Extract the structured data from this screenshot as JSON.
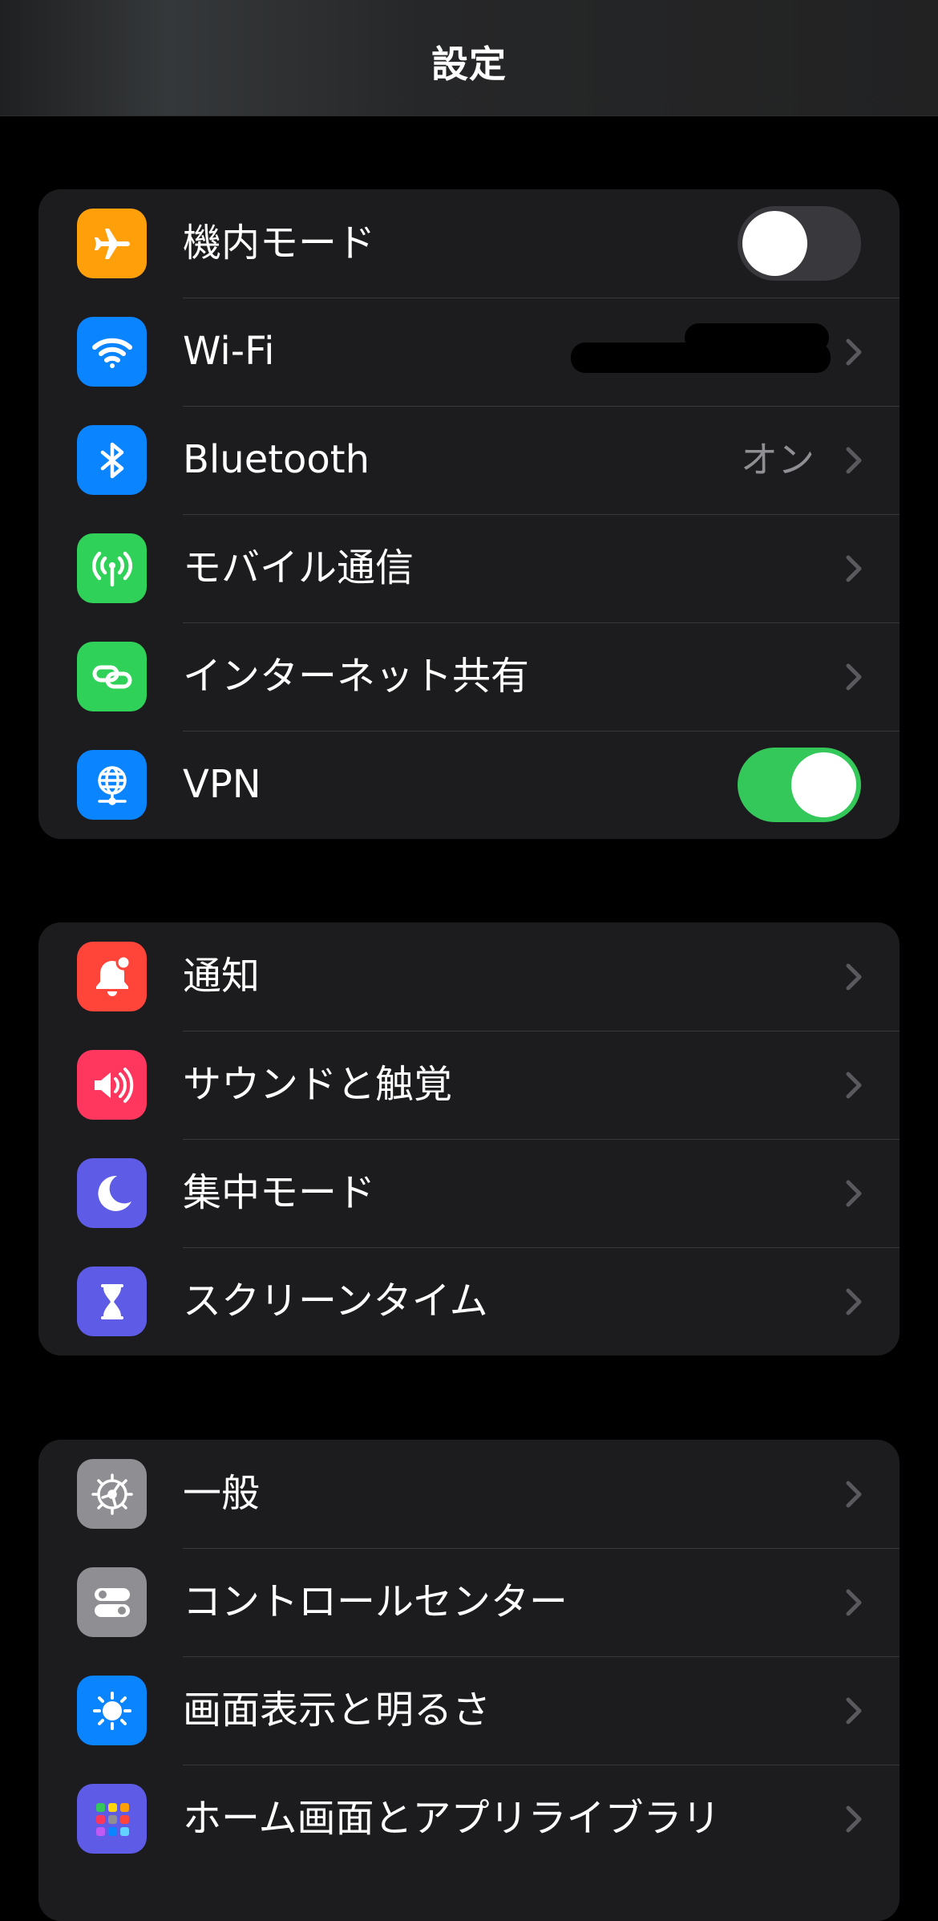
{
  "nav": {
    "title": "設定"
  },
  "groups": [
    {
      "rows": [
        {
          "label": "機内モード",
          "icon": "airplane-icon",
          "color": "#ff9f0a",
          "control": "toggle-off"
        },
        {
          "label": "Wi-Fi",
          "icon": "wifi-icon",
          "color": "#0a84ff",
          "control": "chevron",
          "value": ""
        },
        {
          "label": "Bluetooth",
          "icon": "bluetooth-icon",
          "color": "#0a84ff",
          "control": "chevron",
          "value": "オン"
        },
        {
          "label": "モバイル通信",
          "icon": "cellular-icon",
          "color": "#30d158",
          "control": "chevron"
        },
        {
          "label": "インターネット共有",
          "icon": "hotspot-icon",
          "color": "#30d158",
          "control": "chevron"
        },
        {
          "label": "VPN",
          "icon": "vpn-icon",
          "color": "#0a84ff",
          "control": "toggle-on"
        }
      ]
    },
    {
      "rows": [
        {
          "label": "通知",
          "icon": "notifications-icon",
          "color": "#ff453a",
          "control": "chevron"
        },
        {
          "label": "サウンドと触覚",
          "icon": "sound-icon",
          "color": "#ff375f",
          "control": "chevron"
        },
        {
          "label": "集中モード",
          "icon": "focus-moon-icon",
          "color": "#5e5ce6",
          "control": "chevron"
        },
        {
          "label": "スクリーンタイム",
          "icon": "hourglass-icon",
          "color": "#5e5ce6",
          "control": "chevron"
        }
      ]
    },
    {
      "rows": [
        {
          "label": "一般",
          "icon": "gear-icon",
          "color": "#8e8e93",
          "control": "chevron"
        },
        {
          "label": "コントロールセンター",
          "icon": "control-center-icon",
          "color": "#8e8e93",
          "control": "chevron"
        },
        {
          "label": "画面表示と明るさ",
          "icon": "brightness-icon",
          "color": "#0a84ff",
          "control": "chevron"
        },
        {
          "label": "ホーム画面とアプリライブラリ",
          "icon": "home-screen-icon",
          "color": "#5e5ce6",
          "control": "chevron"
        }
      ]
    }
  ],
  "colors": {
    "background": "#000000",
    "group_bg": "#1c1c1e",
    "separator": "#38383a",
    "secondary_text": "#8e8e93",
    "chevron": "#5a5a5e",
    "toggle_on": "#34c759",
    "toggle_off": "#39393d"
  }
}
